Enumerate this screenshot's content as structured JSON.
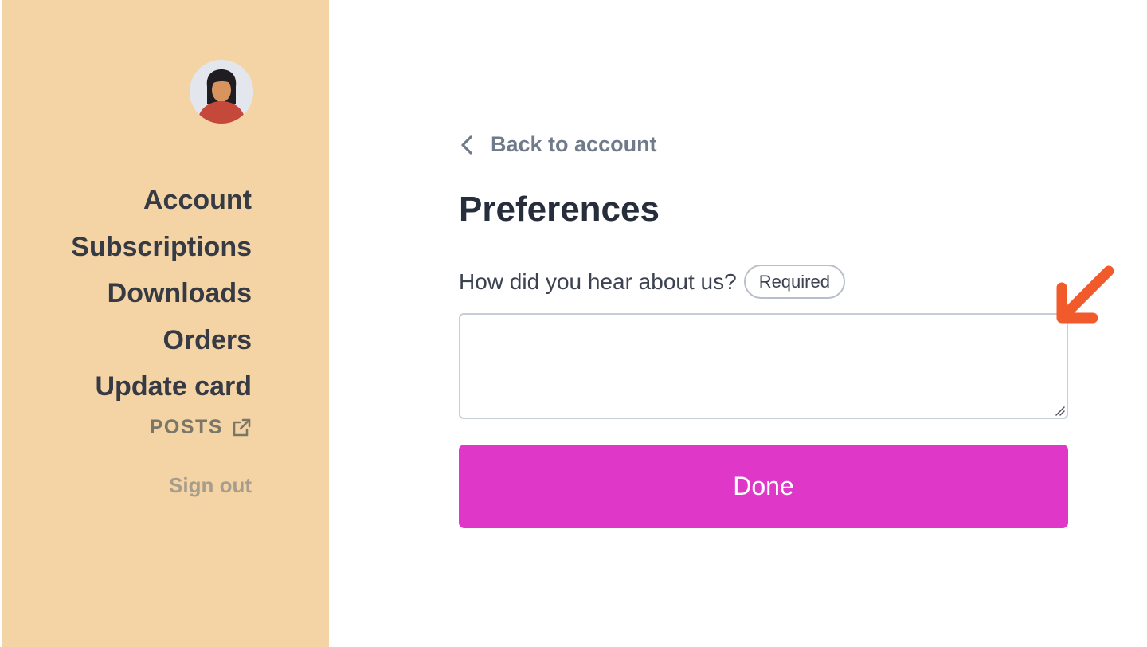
{
  "colors": {
    "sidebar_bg": "#f4d4a4",
    "primary_button": "#df38c9",
    "annotation_arrow": "#f15a2b",
    "text_dark": "#2d3440",
    "text_muted": "#6f7a8a"
  },
  "sidebar": {
    "avatar_icon": "user-avatar",
    "items": [
      {
        "label": "Account"
      },
      {
        "label": "Subscriptions"
      },
      {
        "label": "Downloads"
      },
      {
        "label": "Orders"
      },
      {
        "label": "Update card"
      }
    ],
    "posts": {
      "label": "POSTS",
      "icon": "external-link-icon"
    },
    "sign_out": "Sign out"
  },
  "main": {
    "back_link": {
      "label": "Back to account",
      "icon": "chevron-left-icon"
    },
    "title": "Preferences",
    "field": {
      "label": "How did you hear about us?",
      "badge": "Required",
      "value": "",
      "placeholder": ""
    },
    "done_button": "Done"
  },
  "annotation": {
    "icon": "arrow-down-left-icon"
  }
}
